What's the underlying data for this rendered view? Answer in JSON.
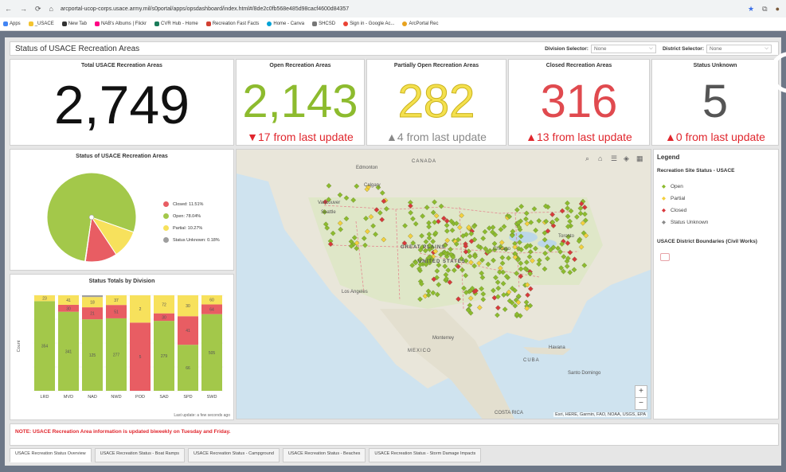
{
  "browser": {
    "url": "arcportal-ucop-corps.usace.army.mil/s0portal/apps/opsdashboard/index.html#/8de2c0fb568e485d98cacf4600d84357",
    "bookmarks": [
      "Apps",
      "_USACE",
      "New Tab",
      "NAB's Albums | Flickr",
      "CVR Hub - Home",
      "Recreation Fast Facts",
      "Home - Canva",
      "SHCSD",
      "Sign in - Google Ac...",
      "ArcPortal Rec"
    ]
  },
  "header": {
    "title": "Status of USACE Recreation Areas",
    "division_label": "Division Selector:",
    "division_value": "None",
    "district_label": "District Selector:",
    "district_value": "None"
  },
  "kpis": {
    "total": {
      "label": "Total USACE Recreation Areas",
      "value": "2,749",
      "color": "#111111"
    },
    "open": {
      "label": "Open Recreation Areas",
      "value": "2,143",
      "sub": "▼17 from last update",
      "color": "#8dbb2e",
      "sub_color": "#e0262d"
    },
    "partial": {
      "label": "Partially Open Recreation Areas",
      "value": "282",
      "sub": "▲4 from last update",
      "color": "#f4e04d",
      "sub_color": "#888888"
    },
    "closed": {
      "label": "Closed Recreation Areas",
      "value": "316",
      "sub": "▲13 from last update",
      "color": "#e04a4f",
      "sub_color": "#e0262d"
    },
    "unknown": {
      "label": "Status Unknown",
      "value": "5",
      "sub": "▲0 from last update",
      "color": "#555555",
      "sub_color": "#e0262d"
    }
  },
  "pie_panel": {
    "title": "Status of USACE Recreation Areas",
    "legend": [
      {
        "label": "Closed: 11.51%",
        "color": "#e85d63"
      },
      {
        "label": "Open: 78.04%",
        "color": "#a3c84a"
      },
      {
        "label": "Partial: 10.27%",
        "color": "#f7e15c"
      },
      {
        "label": "Status Unknown: 0.18%",
        "color": "#9e9e9e"
      }
    ]
  },
  "bar_panel": {
    "title": "Status Totals by Division",
    "ylabel": "Count",
    "footer": "Last update: a few seconds ago",
    "tick_labels": [
      "LRD",
      "MVD",
      "NAD",
      "NWD",
      "POD",
      "SAD",
      "SPD",
      "SWD"
    ]
  },
  "chart_data": [
    {
      "type": "pie",
      "title": "Status of USACE Recreation Areas",
      "slices": [
        {
          "name": "Open",
          "value": 78.04,
          "color": "#a3c84a"
        },
        {
          "name": "Partial",
          "value": 10.27,
          "color": "#f7e15c"
        },
        {
          "name": "Closed",
          "value": 11.51,
          "color": "#e85d63"
        },
        {
          "name": "Status Unknown",
          "value": 0.18,
          "color": "#9e9e9e"
        }
      ]
    },
    {
      "type": "bar",
      "stacked": true,
      "title": "Status Totals by Division",
      "ylabel": "Count",
      "categories": [
        "LRD",
        "MVD",
        "NAD",
        "NWD",
        "POD",
        "SAD",
        "SPD",
        "SWD"
      ],
      "series": [
        {
          "name": "Open",
          "color": "#a3c84a",
          "values": [
            354,
            341,
            125,
            277,
            0,
            279,
            66,
            505
          ]
        },
        {
          "name": "Closed",
          "color": "#e85d63",
          "values": [
            0,
            30,
            21,
            51,
            5,
            30,
            41,
            64
          ]
        },
        {
          "name": "Partial",
          "color": "#f7e15c",
          "values": [
            23,
            41,
            18,
            37,
            2,
            72,
            30,
            60
          ]
        },
        {
          "name": "Status Unknown",
          "color": "#9e9e9e",
          "values": [
            0,
            0,
            3,
            0,
            0,
            0,
            0,
            0
          ]
        }
      ],
      "value_labels": [
        [
          "354",
          "",
          "23"
        ],
        [
          "341",
          "30",
          "41"
        ],
        [
          "125",
          "21",
          "18"
        ],
        [
          "277",
          "51",
          "37"
        ],
        [
          "",
          "5",
          "2"
        ],
        [
          "279",
          "30",
          "72"
        ],
        [
          "66",
          "41",
          "30"
        ],
        [
          "505",
          "64",
          "60"
        ]
      ]
    }
  ],
  "map": {
    "labels": [
      "CANADA",
      "GREAT PLAINS",
      "UNITED STATES",
      "MEXICO",
      "CUBA",
      "Edmonton",
      "Calgary",
      "Vancouver",
      "Seattle",
      "Los Angeles",
      "Chicago",
      "Toronto",
      "Monterrey",
      "Havana",
      "Santo Domingo",
      "COSTA RICA"
    ],
    "attribution": "Esri, HERE, Garmin, FAO, NOAA, USGS, EPA",
    "zoom_in": "+",
    "zoom_out": "−"
  },
  "legend": {
    "title": "Legend",
    "section1": "Recreation Site Status - USACE",
    "items": [
      {
        "label": "Open",
        "color": "#8dbb2e"
      },
      {
        "label": "Partial",
        "color": "#f4d03f"
      },
      {
        "label": "Closed",
        "color": "#d9383d"
      },
      {
        "label": "Status Unknown",
        "color": "#8a8a8a"
      }
    ],
    "section2": "USACE District Boundaries (Civil Works)"
  },
  "note": "NOTE: USACE Recreation Area information is updated biweekly on Tuesday and Friday.",
  "tabs": [
    "USACE Recreation Status Overview",
    "USACE Recreation Status - Boat Ramps",
    "USACE Recreation Status - Campground",
    "USACE Recreation Status - Beaches",
    "USACE Recreation Status - Storm Damage Impacts"
  ]
}
